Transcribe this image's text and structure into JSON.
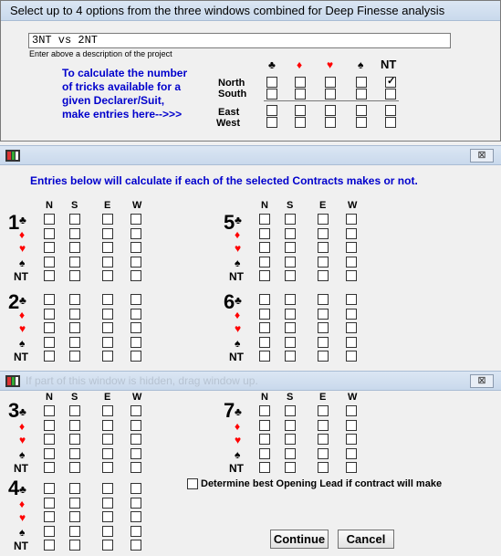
{
  "top": {
    "title": "Select up to 4 options from the three windows combined for Deep Finesse analysis",
    "description_value": "3NT vs 2NT",
    "description_note": "Enter above a description of the project",
    "calc_text": [
      "To calculate the number",
      "of tricks available for a",
      "given Declarer/Suit,",
      "make entries here-->>>"
    ],
    "directions": [
      "North",
      "South",
      "East",
      "West"
    ],
    "strains": [
      "♣",
      "♦",
      "♥",
      "♠",
      "NT"
    ],
    "checked": "North-NT"
  },
  "win2": {
    "entries_text": "Entries below will calculate if each of the selected Contracts makes or not.",
    "close": "⊠"
  },
  "win3": {
    "hint": "If part of this window is hidden, drag window up.",
    "close": "⊠",
    "lead_label": "Determine best Opening Lead if contract will make",
    "continue_label": "Continue",
    "cancel_label": "Cancel"
  },
  "grid": {
    "col_labels": [
      "N",
      "S",
      "E",
      "W"
    ],
    "strains": [
      "♣",
      "♦",
      "♥",
      "♠",
      "NT"
    ],
    "contracts": [
      "1",
      "2",
      "3",
      "4",
      "5",
      "6",
      "7"
    ]
  },
  "colors": {
    "title_grad": "#c9d9ec",
    "link_blue": "#0000cc",
    "red_suit": "#ff0000"
  }
}
